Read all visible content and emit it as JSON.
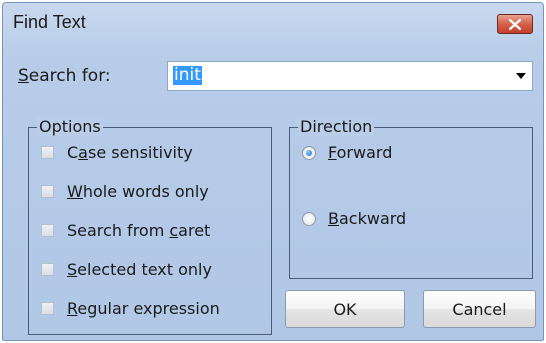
{
  "window": {
    "title": "Find Text"
  },
  "search": {
    "label": "Search for:",
    "value": "init"
  },
  "options": {
    "legend": "Options",
    "items": [
      {
        "label": "Case sensitivity",
        "checked": false
      },
      {
        "label": "Whole words only",
        "checked": false
      },
      {
        "label": "Search from caret",
        "checked": false
      },
      {
        "label": "Selected text only",
        "checked": false
      },
      {
        "label": "Regular expression",
        "checked": false
      }
    ]
  },
  "direction": {
    "legend": "Direction",
    "items": [
      {
        "label": "Forward",
        "selected": true
      },
      {
        "label": "Backward",
        "selected": false
      }
    ]
  },
  "buttons": {
    "ok": "OK",
    "cancel": "Cancel"
  },
  "colors": {
    "close_button": "#d6604b",
    "selection": "#3399ff",
    "dialog_bg": "#b9cde9"
  }
}
